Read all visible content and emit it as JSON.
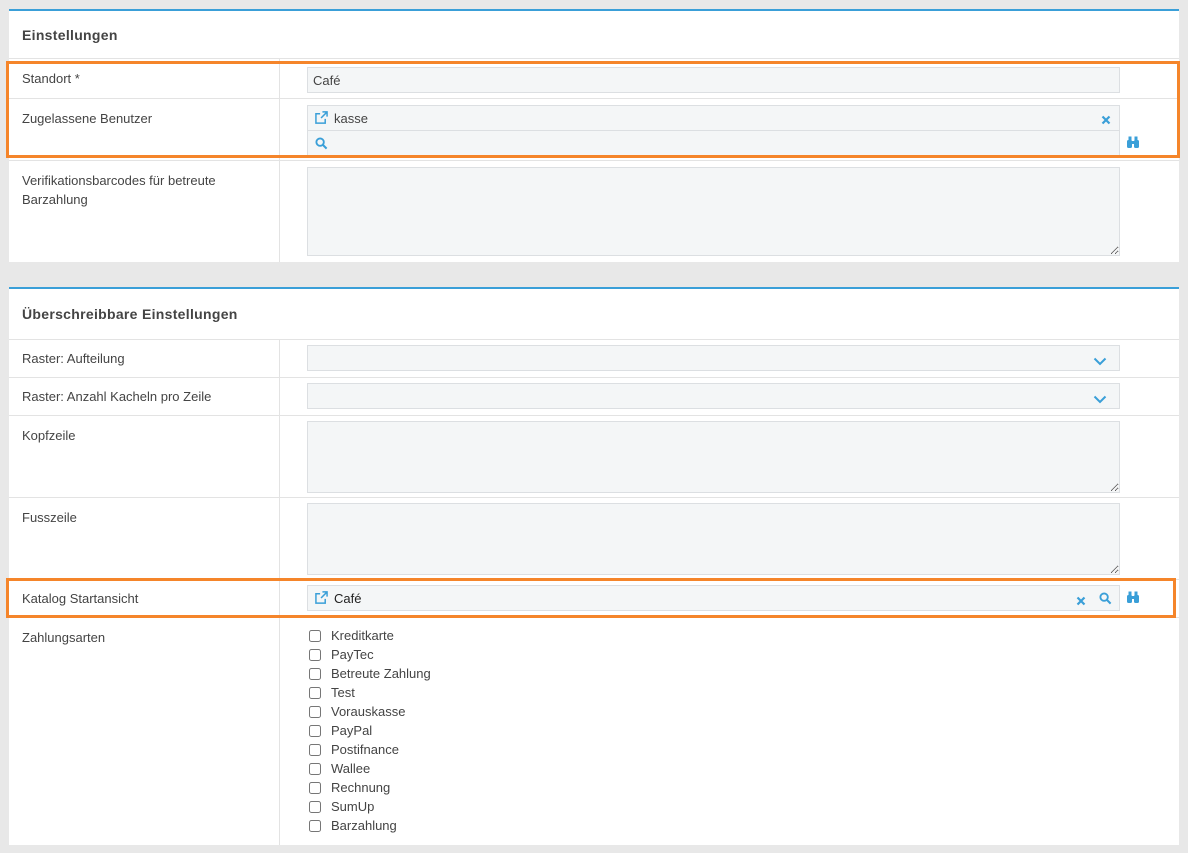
{
  "settings": {
    "title": "Einstellungen",
    "location": {
      "label": "Standort *",
      "value": "Café"
    },
    "allowed_users": {
      "label": "Zugelassene Benutzer",
      "value": "kasse",
      "search_value": ""
    },
    "verification": {
      "label": "Verifikationsbarcodes für betreute Barzahlung",
      "value": ""
    }
  },
  "overridable": {
    "title": "Überschreibbare Einstellungen",
    "grid_split": {
      "label": "Raster: Aufteilung",
      "value": ""
    },
    "grid_tiles": {
      "label": "Raster: Anzahl Kacheln pro Zeile",
      "value": ""
    },
    "header": {
      "label": "Kopfzeile",
      "value": ""
    },
    "footer": {
      "label": "Fusszeile",
      "value": ""
    },
    "catalog_start": {
      "label": "Katalog Startansicht",
      "value": "Café"
    },
    "payment": {
      "label": "Zahlungsarten",
      "options": [
        "Kreditkarte",
        "PayTec",
        "Betreute Zahlung",
        "Test",
        "Vorauskasse",
        "PayPal",
        "Postifnance",
        "Wallee",
        "Rechnung",
        "SumUp",
        "Barzahlung"
      ]
    }
  },
  "colors": {
    "accent": "#3a9fd8",
    "highlight": "#f5852a"
  }
}
